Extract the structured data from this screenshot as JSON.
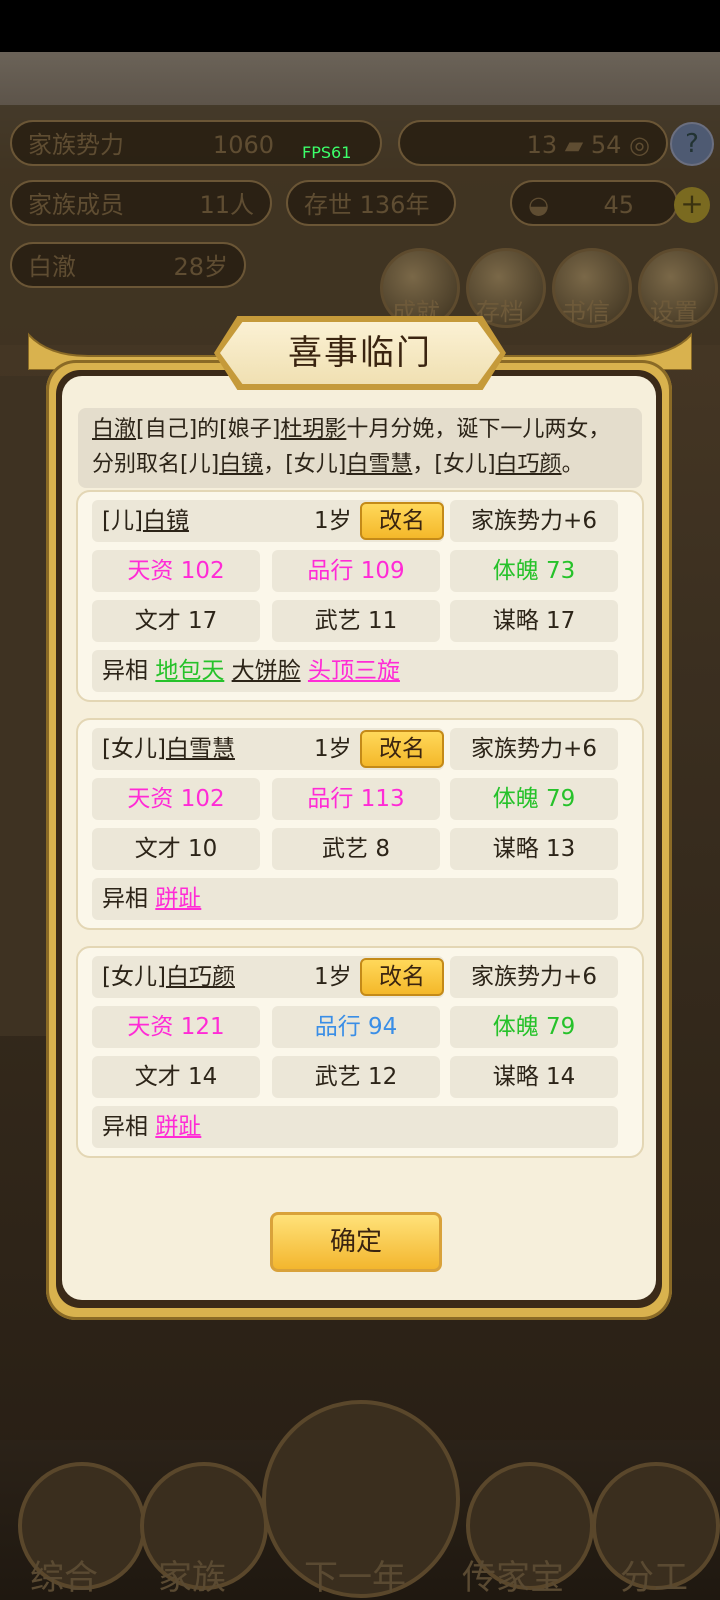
{
  "background": {
    "fps": "FPS61",
    "family_power_label": "家族势力",
    "family_power_value": "1060",
    "currency_a": "13",
    "currency_b": "54",
    "members_label": "家族成员",
    "members_value": "11人",
    "survival_label": "存世",
    "survival_value": "136年",
    "gold_value": "45",
    "person_name": "白澈",
    "person_age": "28岁",
    "menu_achievements": "成就",
    "menu_save": "存档",
    "menu_letters": "书信",
    "menu_settings": "设置",
    "bottom_overview": "综合",
    "bottom_family": "家族",
    "bottom_next_year": "下一年",
    "bottom_heirloom": "传家宝",
    "bottom_division": "分工"
  },
  "dialog": {
    "title": "喜事临门",
    "announcement": {
      "p1": "白澈",
      "p2": "[自己]的[娘子]",
      "p3": "杜玥影",
      "p4": "十月分娩，诞下一儿两女，",
      "p5": "分别取名[儿]",
      "p6": "白镜",
      "p7": "，[女儿]",
      "p8": "白雪慧",
      "p9": "，[女儿]",
      "p10": "白巧颜",
      "p11": "。"
    },
    "children": [
      {
        "relation": "[儿]",
        "name": "白镜",
        "age": "1岁",
        "rename": "改名",
        "power": "家族势力+6",
        "talent": "天资 102",
        "conduct": "品行 109",
        "physique": "体魄 73",
        "literary": "文才 17",
        "martial": "武艺 11",
        "strategy": "谋略 17",
        "trait_label": "异相",
        "traits": [
          "地包天",
          "大饼脸",
          "头顶三旋"
        ]
      },
      {
        "relation": "[女儿]",
        "name": "白雪慧",
        "age": "1岁",
        "rename": "改名",
        "power": "家族势力+6",
        "talent": "天资 102",
        "conduct": "品行 113",
        "physique": "体魄 79",
        "literary": "文才 10",
        "martial": "武艺 8",
        "strategy": "谋略 13",
        "trait_label": "异相",
        "traits": [
          "跰趾"
        ]
      },
      {
        "relation": "[女儿]",
        "name": "白巧颜",
        "age": "1岁",
        "rename": "改名",
        "power": "家族势力+6",
        "talent": "天资 121",
        "conduct": "品行 94",
        "physique": "体魄 79",
        "literary": "文才 14",
        "martial": "武艺 12",
        "strategy": "谋略 14",
        "trait_label": "异相",
        "traits": [
          "跰趾"
        ]
      }
    ],
    "confirm": "确定"
  },
  "colors": {
    "talent": "#ff2bd6",
    "conduct_high": "#ff2bd6",
    "conduct_normal": "#3a8ee6",
    "physique": "#26c22a",
    "trait_green": "#26c22a",
    "trait_black": "#2c2418",
    "trait_pink": "#ff2bd6"
  }
}
